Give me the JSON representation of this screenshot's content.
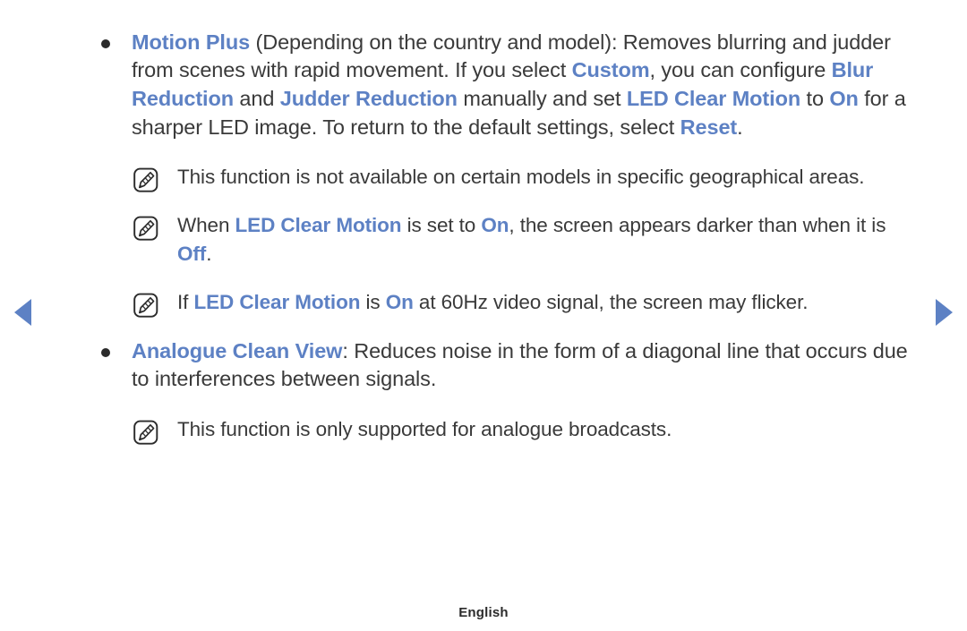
{
  "page": {
    "language_footer": "English",
    "accent_color": "#5d81c4",
    "body_color": "#3a3a3a",
    "background_color": "#ffffff"
  },
  "navigation": {
    "prev_label": "prev-page-arrow",
    "next_label": "next-page-arrow"
  },
  "icons": {
    "note": "note-pencil-icon",
    "bullet": "bullet-dot-icon",
    "prev_arrow": "triangle-left-icon",
    "next_arrow": "triangle-right-icon"
  },
  "content": {
    "items": [
      {
        "type": "bullet",
        "runs": [
          {
            "text": "Motion Plus",
            "style": "keyword"
          },
          {
            "text": " (Depending on the country and model): Removes blurring and judder from scenes with rapid movement. If you select ",
            "style": "body"
          },
          {
            "text": "Custom",
            "style": "keyword"
          },
          {
            "text": ", you can configure ",
            "style": "body"
          },
          {
            "text": "Blur Reduction",
            "style": "keyword"
          },
          {
            "text": " and ",
            "style": "body"
          },
          {
            "text": "Judder Reduction",
            "style": "keyword"
          },
          {
            "text": " manually and set ",
            "style": "body"
          },
          {
            "text": "LED Clear Motion",
            "style": "keyword"
          },
          {
            "text": " to ",
            "style": "body"
          },
          {
            "text": "On",
            "style": "keyword"
          },
          {
            "text": " for a sharper LED image. To return to the default settings, select ",
            "style": "body"
          },
          {
            "text": "Reset",
            "style": "keyword"
          },
          {
            "text": ".",
            "style": "body"
          }
        ]
      },
      {
        "type": "note",
        "runs": [
          {
            "text": "This function is not available on certain models in specific geographical areas.",
            "style": "body"
          }
        ]
      },
      {
        "type": "note",
        "runs": [
          {
            "text": "When ",
            "style": "body"
          },
          {
            "text": "LED Clear Motion",
            "style": "keyword"
          },
          {
            "text": " is set to ",
            "style": "body"
          },
          {
            "text": "On",
            "style": "keyword"
          },
          {
            "text": ", the screen appears darker than when it is ",
            "style": "body"
          },
          {
            "text": "Off",
            "style": "keyword"
          },
          {
            "text": ".",
            "style": "body"
          }
        ]
      },
      {
        "type": "note",
        "runs": [
          {
            "text": "If ",
            "style": "body"
          },
          {
            "text": "LED Clear Motion",
            "style": "keyword"
          },
          {
            "text": " is ",
            "style": "body"
          },
          {
            "text": "On",
            "style": "keyword"
          },
          {
            "text": " at 60Hz video signal, the screen may flicker.",
            "style": "body"
          }
        ]
      },
      {
        "type": "bullet",
        "runs": [
          {
            "text": "Analogue Clean View",
            "style": "keyword"
          },
          {
            "text": ": Reduces noise in the form of a diagonal line that occurs due to interferences between signals.",
            "style": "body"
          }
        ]
      },
      {
        "type": "note",
        "runs": [
          {
            "text": "This function is only supported for analogue broadcasts.",
            "style": "body"
          }
        ]
      }
    ]
  }
}
